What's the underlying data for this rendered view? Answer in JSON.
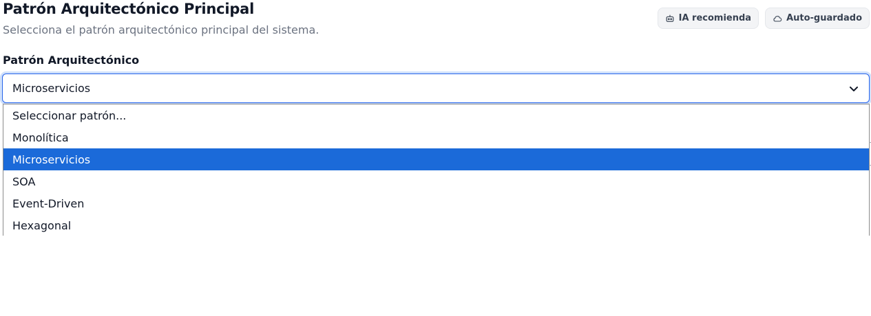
{
  "header": {
    "title": "Patrón Arquitectónico Principal",
    "subtitle": "Selecciona el patrón arquitectónico principal del sistema."
  },
  "badges": [
    {
      "label": "IA recomienda",
      "icon": "robot-icon"
    },
    {
      "label": "Auto-guardado",
      "icon": "cloud-icon"
    }
  ],
  "field": {
    "label": "Patrón Arquitectónico",
    "value": "Microservicios"
  },
  "dropdown": {
    "options": [
      "Seleccionar patrón...",
      "Monolítica",
      "Microservicios",
      "SOA",
      "Event-Driven",
      "Hexagonal"
    ],
    "selected_index": 2
  },
  "colors": {
    "accent": "#1b6ad9",
    "focus_ring": "#cfe0fb",
    "subtitle": "#6b7280"
  }
}
